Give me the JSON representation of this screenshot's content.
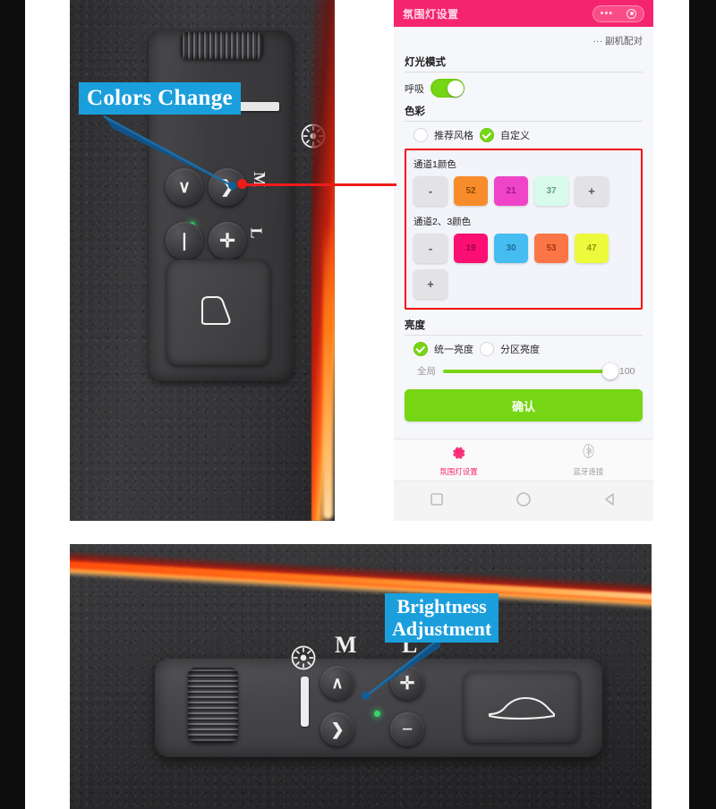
{
  "callouts": [
    {
      "id": "colors-change",
      "text": "Colors Change",
      "color": "#1b9fdc"
    },
    {
      "id": "brightness-adjustment",
      "line1": "Brightness",
      "line2": "Adjustment",
      "color": "#1b9fdc"
    }
  ],
  "phone": {
    "header": {
      "title": "氛围灯设置",
      "capsule_dots": "•••",
      "capsule_target_icon": "target-icon"
    },
    "pairing": {
      "prefix": "···",
      "label": "副机配对"
    },
    "light_mode": {
      "section_title": "灯光模式",
      "toggle_label": "呼吸",
      "toggle_state": "on"
    },
    "color": {
      "section_title": "色彩",
      "options": [
        {
          "label": "推荐风格",
          "selected": false
        },
        {
          "label": "自定义",
          "selected": true
        }
      ],
      "channel1": {
        "label": "通道1颜色",
        "swatches": [
          {
            "value": "-",
            "bg": "#e3e3e5",
            "fg": "#555555",
            "kind": "minus"
          },
          {
            "value": "52",
            "bg": "#f98c2a",
            "fg": "#8a4a06",
            "kind": "color"
          },
          {
            "value": "21",
            "bg": "#ef44c8",
            "fg": "#9b1b7c",
            "kind": "color"
          },
          {
            "value": "37",
            "bg": "#d8fbec",
            "fg": "#5f9e86",
            "kind": "color"
          },
          {
            "value": "+",
            "bg": "#e3e3e5",
            "fg": "#333333",
            "kind": "plus"
          }
        ]
      },
      "channel23": {
        "label": "通道2、3颜色",
        "swatches": [
          {
            "value": "-",
            "bg": "#e3e3e5",
            "fg": "#555555",
            "kind": "minus"
          },
          {
            "value": "19",
            "bg": "#fb0f72",
            "fg": "#9c0647",
            "kind": "color"
          },
          {
            "value": "30",
            "bg": "#45bdf0",
            "fg": "#1b6d94",
            "kind": "color"
          },
          {
            "value": "53",
            "bg": "#fb7646",
            "fg": "#a63412",
            "kind": "color"
          },
          {
            "value": "47",
            "bg": "#ecfa3c",
            "fg": "#8d9608",
            "kind": "color"
          },
          {
            "value": "+",
            "bg": "#e3e3e5",
            "fg": "#333333",
            "kind": "plus"
          }
        ]
      },
      "highlight_color": "#f40d0d"
    },
    "brightness": {
      "section_title": "亮度",
      "options": [
        {
          "label": "统一亮度",
          "selected": true
        },
        {
          "label": "分区亮度",
          "selected": false
        }
      ],
      "slider": {
        "label": "全局",
        "value": "100",
        "percent": 100,
        "track_color": "#76d613"
      }
    },
    "confirm_button": "确认",
    "tabs": [
      {
        "label": "氛围灯设置",
        "icon": "gear-icon",
        "active": true
      },
      {
        "label": "蓝牙连接",
        "icon": "bluetooth-icon",
        "active": false
      }
    ],
    "android_nav": [
      {
        "icon": "square-recents-icon"
      },
      {
        "icon": "circle-home-icon"
      },
      {
        "icon": "triangle-back-icon"
      }
    ]
  },
  "photos": {
    "top": {
      "name": "volvo-seat-control-panel-vertical",
      "buttons": [
        {
          "glyph": "∨",
          "name": "down-arrow-button"
        },
        {
          "glyph": "❯",
          "name": "right-arrow-button"
        },
        {
          "glyph": "❘",
          "name": "bar-button"
        },
        {
          "glyph": "✛",
          "name": "plus-button"
        }
      ],
      "marks": [
        "M",
        "L"
      ]
    },
    "bottom": {
      "name": "volvo-dashboard-control-panel",
      "marks": [
        "M",
        "L"
      ],
      "buttons": [
        {
          "glyph": "∧",
          "name": "up-arrow-button"
        },
        {
          "glyph": "✛",
          "name": "plus-button"
        },
        {
          "glyph": "❯",
          "name": "right-arrow-button"
        },
        {
          "glyph": "−",
          "name": "minus-button"
        }
      ]
    }
  }
}
